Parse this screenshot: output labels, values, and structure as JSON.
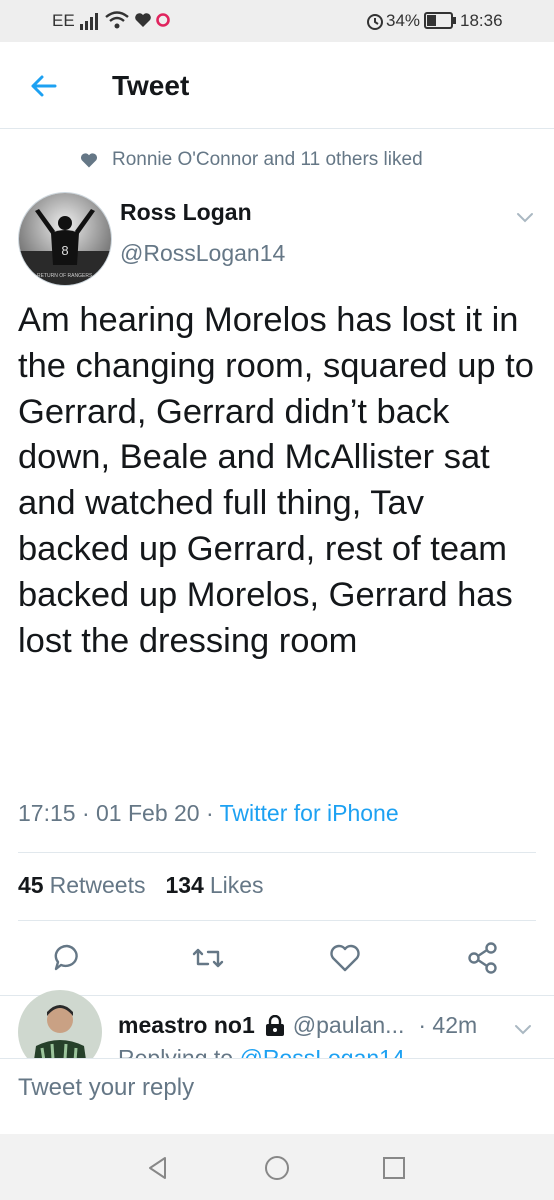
{
  "status_bar": {
    "carrier": "EE",
    "battery": "34%",
    "time": "18:36"
  },
  "header": {
    "title": "Tweet"
  },
  "social_context": {
    "text": "Ronnie O'Connor and 11 others liked"
  },
  "tweet": {
    "author_name": "Ross Logan",
    "author_handle": "@RossLogan14",
    "avatar_number": "8",
    "avatar_caption": "RETURN OF RANGERS",
    "text": "Am hearing Morelos has lost it in the changing room, squared up to Gerrard, Gerrard didn’t back down, Beale and McAllister sat and watched full thing, Tav backed up Gerrard, rest of team backed up Morelos, Gerrard has lost the dressing room",
    "time": "17:15",
    "date": "01 Feb 20",
    "source": "Twitter for iPhone",
    "retweets_count": "45",
    "retweets_label": "Retweets",
    "likes_count": "134",
    "likes_label": "Likes"
  },
  "reply_preview": {
    "name": "meastro no1",
    "handle": "@paulan...",
    "time": "· 42m",
    "replying_prefix": "Replying to",
    "replying_handle": "@RossLogan14"
  },
  "compose": {
    "placeholder": "Tweet your reply"
  },
  "colors": {
    "accent": "#1da1f2",
    "secondary_text": "#657786",
    "primary_text": "#14171a"
  }
}
